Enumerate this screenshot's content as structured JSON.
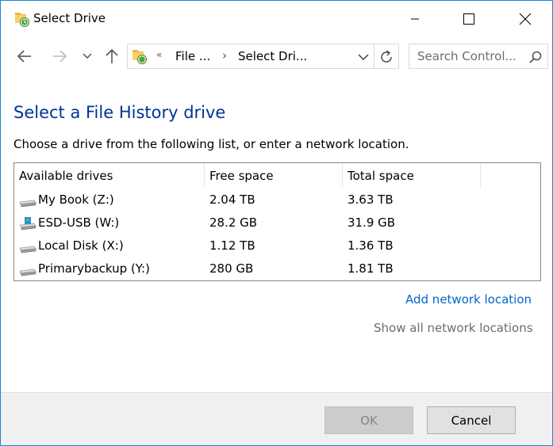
{
  "window": {
    "title": "Select Drive"
  },
  "nav": {
    "address_chevron": "«",
    "address_seg1": "File ...",
    "address_sep": "›",
    "address_seg2": "Select Dri...",
    "search_placeholder": "Search Control..."
  },
  "content": {
    "heading": "Select a File History drive",
    "instruction": "Choose a drive from the following list, or enter a network location.",
    "columns": [
      "Available drives",
      "Free space",
      "Total space"
    ],
    "drives": [
      {
        "name": "My Book (Z:)",
        "free": "2.04 TB",
        "total": "3.63 TB",
        "icon": "external-drive-icon"
      },
      {
        "name": "ESD-USB (W:)",
        "free": "28.2 GB",
        "total": "31.9 GB",
        "icon": "usb-setup-drive-icon"
      },
      {
        "name": "Local Disk (X:)",
        "free": "1.12 TB",
        "total": "1.36 TB",
        "icon": "local-disk-icon"
      },
      {
        "name": "Primarybackup (Y:)",
        "free": "280 GB",
        "total": "1.81 TB",
        "icon": "backup-drive-icon"
      }
    ],
    "add_network_location": "Add network location",
    "show_all_network_locations": "Show all network locations"
  },
  "footer": {
    "ok_label": "OK",
    "cancel_label": "Cancel"
  },
  "colors": {
    "heading": "#003399",
    "link": "#0066cc",
    "disabled_link": "#6d6d6d",
    "window_border": "#1883d7"
  }
}
